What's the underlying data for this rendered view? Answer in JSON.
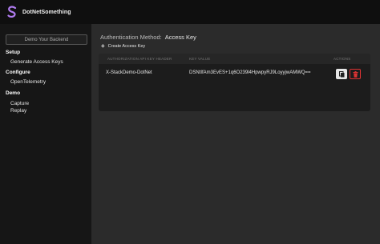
{
  "app": {
    "title": "DotNetSomething"
  },
  "sidebar": {
    "backend_button": "Demo Your Backend",
    "sections": [
      {
        "label": "Setup",
        "items": [
          "Generate Access Keys"
        ]
      },
      {
        "label": "Configure",
        "items": [
          "OpenTelemetry"
        ]
      },
      {
        "label": "Demo",
        "items": [
          "Capture",
          "Replay"
        ]
      }
    ]
  },
  "main": {
    "auth_label": "Authentication Method:",
    "auth_value": "Access Key",
    "create_label": "Create Access Key",
    "table": {
      "headers": [
        "AUTHORIZATION API KEY HEADER",
        "KEY VALUE",
        "ACTIONS"
      ],
      "rows": [
        {
          "header": "X-StackDemo-DotNet",
          "key": "DSNtIfAm3EvES+1q6O239l4HpwpyRJ9LoyyjwAMWQ=="
        }
      ]
    }
  },
  "colors": {
    "accent": "#b07cf0",
    "danger": "#dd3333"
  }
}
